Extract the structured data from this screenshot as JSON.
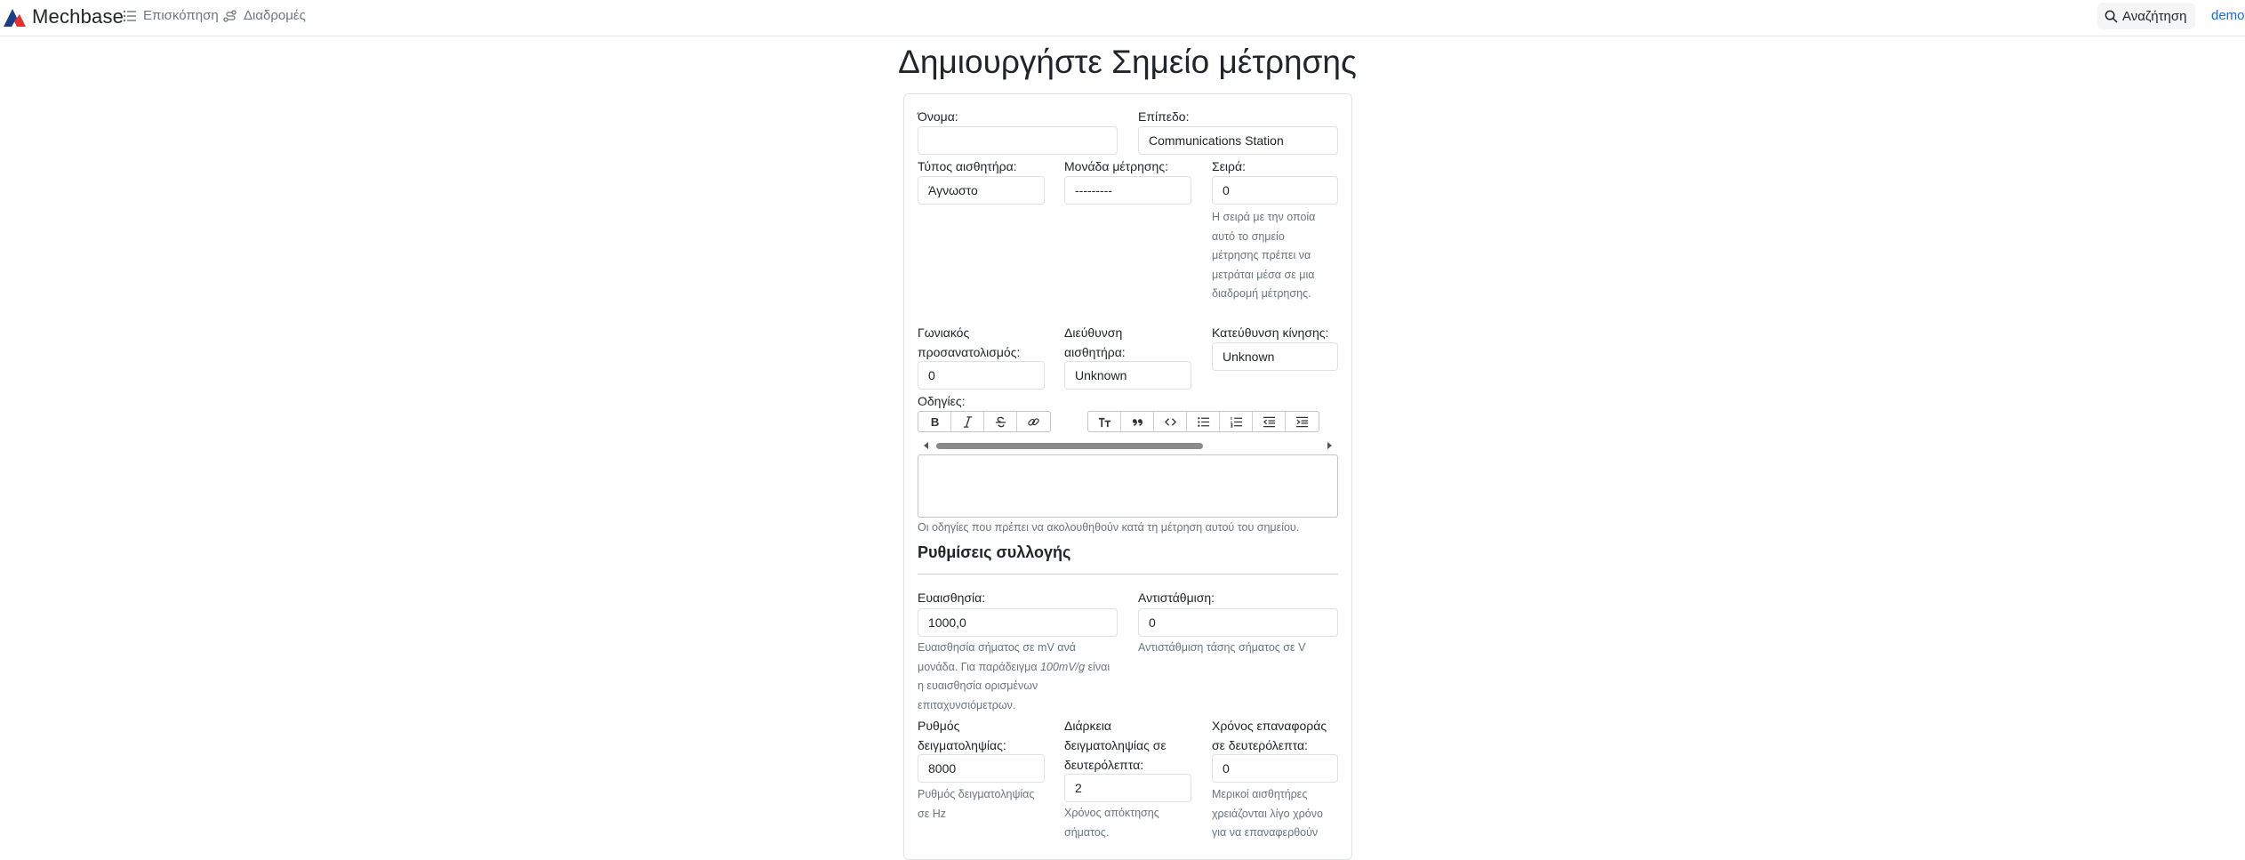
{
  "navbar": {
    "brand": "Mechbase",
    "overview": "Επισκόπηση",
    "routes": "Διαδρομές",
    "search": "Αναζήτηση",
    "user": "demo",
    "accent_color": "#0d6efd"
  },
  "page": {
    "title": "Δημιουργήστε Σημείο μέτρησης"
  },
  "form": {
    "name_label": "Όνομα:",
    "name_value": "",
    "level_label": "Επίπεδο:",
    "level_value": "Communications Station",
    "sensor_type_label": "Τύπος αισθητήρα:",
    "sensor_type_value": "Άγνωστο",
    "unit_label": "Μονάδα μέτρησης:",
    "unit_value": "---------",
    "order_label": "Σειρά:",
    "order_value": "0",
    "order_help": [
      "Η σειρά με την οποία",
      "αυτό το σημείο",
      "μέτρησης πρέπει να",
      "μετράται μέσα σε μια",
      "διαδρομή μέτρησης."
    ],
    "angular_label": [
      "Γωνιακός",
      "προσανατολισμός:"
    ],
    "angular_value": "0",
    "sensor_dir_label": [
      "Διεύθυνση",
      "αισθητήρα:"
    ],
    "sensor_dir_value": "Unknown",
    "motion_dir_label": "Κατεύθυνση κίνησης:",
    "motion_dir_value": "Unknown",
    "instructions_label": "Οδηγίες:",
    "instructions_help": "Οι οδηγίες που πρέπει να ακολουθηθούν κατά τη μέτρηση αυτού του σημείου.",
    "toolbar_icons": [
      "bold-icon",
      "italic-icon",
      "strikethrough-icon",
      "link-icon",
      "heading-icon",
      "quote-icon",
      "code-icon",
      "bullet-list-icon",
      "numbered-list-icon",
      "outdent-icon",
      "indent-icon"
    ]
  },
  "collection": {
    "title": "Ρυθμίσεις συλλογής",
    "sensitivity_label": "Ευαισθησία:",
    "sensitivity_value": "1000,0",
    "sensitivity_help": {
      "l1": "Ευαισθησία σήματος σε mV ανά",
      "l2a": "μονάδα. Για παράδειγμα ",
      "l2b": "100mV/g",
      "l2c": " είναι",
      "l3": "η ευαισθησία ορισμένων",
      "l4": "επιταχυνσιόμετρων."
    },
    "offset_label": "Αντιστάθμιση:",
    "offset_value": "0",
    "offset_help": "Αντιστάθμιση τάσης σήματος σε V",
    "rate_label": [
      "Ρυθμός",
      "δειγματοληψίας:"
    ],
    "rate_value": "8000",
    "rate_help": [
      "Ρυθμός δειγματοληψίας",
      "σε Hz"
    ],
    "duration_label": [
      "Διάρκεια",
      "δειγματοληψίας σε",
      "δευτερόλεπτα:"
    ],
    "duration_value": "2",
    "duration_help": [
      "Χρόνος απόκτησης",
      "σήματος."
    ],
    "recovery_label": [
      "Χρόνος επαναφοράς",
      "σε δευτερόλεπτα:"
    ],
    "recovery_value": "0",
    "recovery_help": [
      "Μερικοί αισθητήρες",
      "χρειάζονται λίγο χρόνο",
      "για να επαναφερθούν"
    ]
  }
}
